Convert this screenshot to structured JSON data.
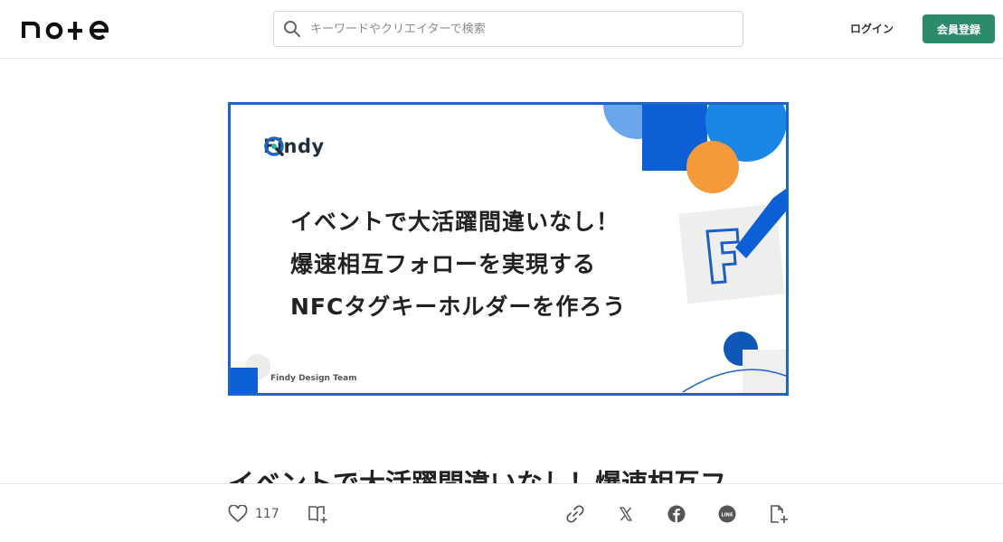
{
  "header": {
    "logo_text": "note",
    "search": {
      "placeholder": "キーワードやクリエイターで検索",
      "value": ""
    },
    "login_label": "ログイン",
    "signup_label": "会員登録",
    "accent_color": "#2d8a6d"
  },
  "eyecatch": {
    "brand": "Findy",
    "headline_lines": [
      "イベントで大活躍間違いなし！",
      "爆速相互フォローを実現する",
      "NFCタグキーホルダーを作ろう"
    ],
    "team": "Findy Design Team",
    "border_color": "#1a66c7"
  },
  "article": {
    "title": "イベントで大活躍間違いなし！爆速相互フ"
  },
  "actions": {
    "like_count": "117",
    "icons": [
      "heart-icon",
      "magazine-add-icon",
      "link-icon",
      "x-icon",
      "facebook-icon",
      "line-icon",
      "note-add-icon"
    ]
  }
}
